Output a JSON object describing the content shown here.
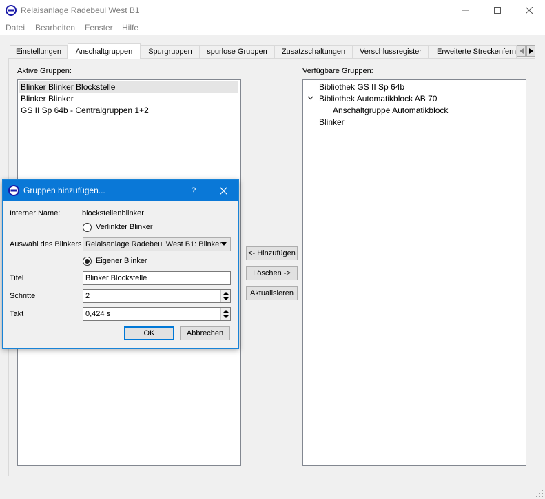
{
  "window": {
    "title": "Relaisanlage Radebeul West B1"
  },
  "menu": [
    "Datei",
    "Bearbeiten",
    "Fenster",
    "Hilfe"
  ],
  "tabs": [
    {
      "label": "Einstellungen"
    },
    {
      "label": "Anschaltgruppen",
      "active": true
    },
    {
      "label": "Spurgruppen"
    },
    {
      "label": "spurlose Gruppen"
    },
    {
      "label": "Zusatzschaltungen"
    },
    {
      "label": "Verschlussregister"
    },
    {
      "label": "Erweiterte Streckenfern"
    }
  ],
  "left_panel": {
    "label": "Aktive Gruppen:",
    "items": [
      "Blinker Blinker Blockstelle",
      "Blinker Blinker",
      "GS II Sp 64b - Centralgruppen 1+2"
    ]
  },
  "right_panel": {
    "label": "Verfügbare Gruppen:",
    "items": [
      "Bibliothek GS II Sp 64b",
      "Bibliothek Automatikblock AB 70",
      "Anschaltgruppe Automatikblock",
      "Blinker"
    ]
  },
  "buttons": {
    "add": "<- Hinzufügen",
    "delete": "Löschen ->",
    "refresh": "Aktualisieren"
  },
  "dialog": {
    "title": "Gruppen hinzufügen...",
    "help": "?",
    "internal_name_label": "Interner Name:",
    "internal_name_value": "blockstellenblinker",
    "radio_linked": "Verlinkter Blinker",
    "blinker_select_label": "Auswahl des Blinkers",
    "blinker_select_value": "Relaisanlage Radebeul West B1: Blinker",
    "radio_own": "Eigener Blinker",
    "title_label": "Titel",
    "title_value": "Blinker Blockstelle",
    "steps_label": "Schritte",
    "steps_value": "2",
    "takt_label": "Takt",
    "takt_value": "0,424 s",
    "ok": "OK",
    "cancel": "Abbrechen"
  },
  "colors": {
    "accent": "#0a78d7",
    "selection": "#e5e5e5"
  }
}
